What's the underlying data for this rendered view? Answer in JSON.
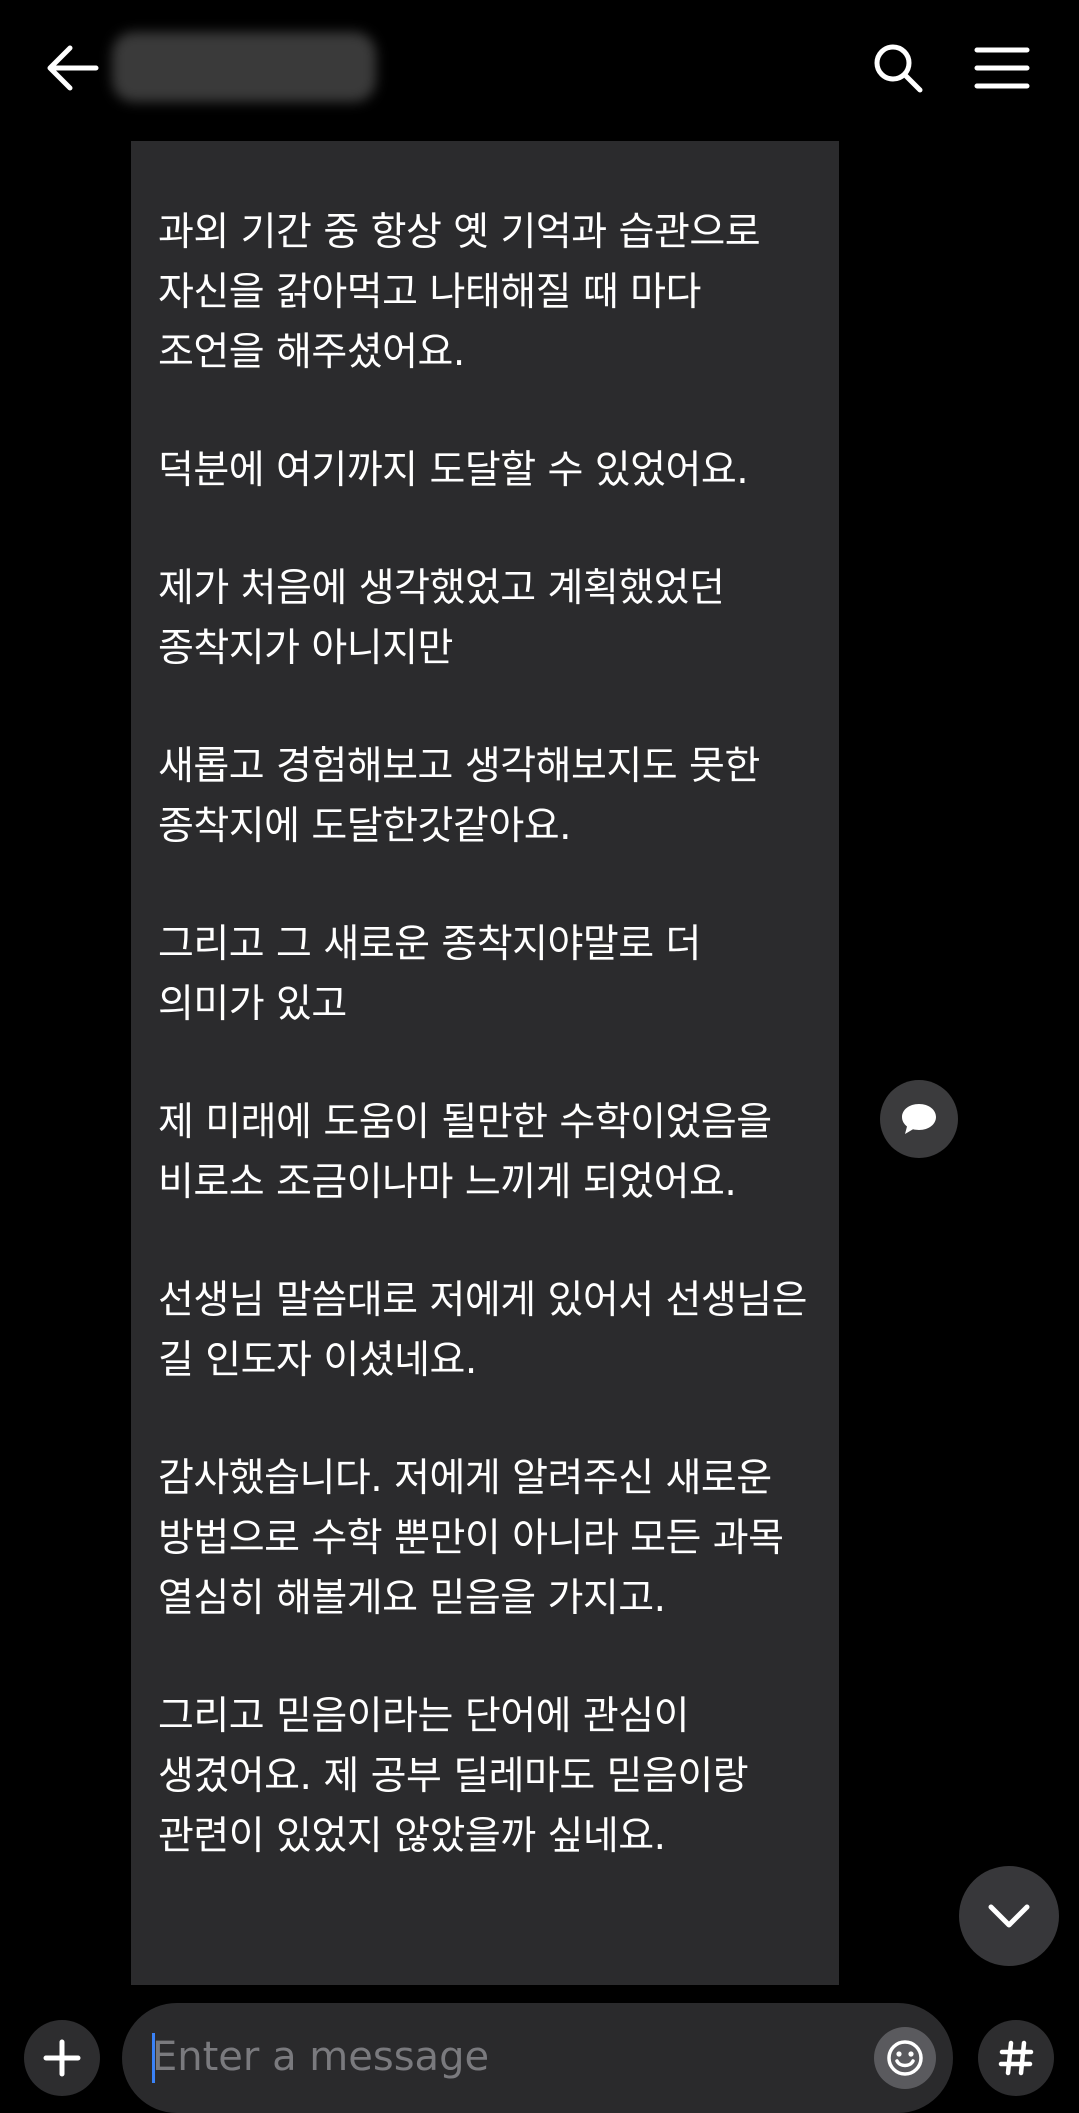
{
  "header": {
    "chat_title": "",
    "back_icon": "arrow-left-icon",
    "search_icon": "search-icon",
    "menu_icon": "hamburger-menu-icon"
  },
  "message": {
    "paragraphs": [
      "과외 기간 중 항상 옛 기억과 습관으로 자신을 갉아먹고 나태해질 때 마다 조언을 해주셨어요.",
      "덕분에 여기까지 도달할 수 있었어요.",
      "제가 처음에 생각했었고 계획했었던 종착지가 아니지만",
      "새롭고 경험해보고 생각해보지도 못한 종착지에 도달한갓같아요.",
      "그리고 그 새로운 종착지야말로 더 의미가 있고",
      "제 미래에 도움이 될만한 수학이었음을 비로소 조금이나마 느끼게 되었어요.",
      "선생님 말씀대로 저에게 있어서 선생님은 길 인도자 이셨네요.",
      "감사했습니다. 저에게 알려주신 새로운 방법으로 수학 뿐만이 아니라 모든 과목 열심히 해볼게요 믿음을 가지고.",
      "그리고 믿음이라는 단어에 관심이 생겼어요. 제 공부 딜레마도 믿음이랑 관련이 있었지 않았을까 싶네요."
    ]
  },
  "floating": {
    "comment_icon": "speech-bubble-icon",
    "scroll_down_icon": "chevron-down-icon"
  },
  "composer": {
    "placeholder": "Enter a message",
    "value": "",
    "plus_icon": "plus-icon",
    "emoji_icon": "emoji-icon",
    "hash_icon": "hash-icon"
  },
  "colors": {
    "background": "#000000",
    "bubble": "#2b2b2d",
    "text": "#ffffff",
    "placeholder": "#7a7a7e",
    "caret": "#3a82f7"
  }
}
